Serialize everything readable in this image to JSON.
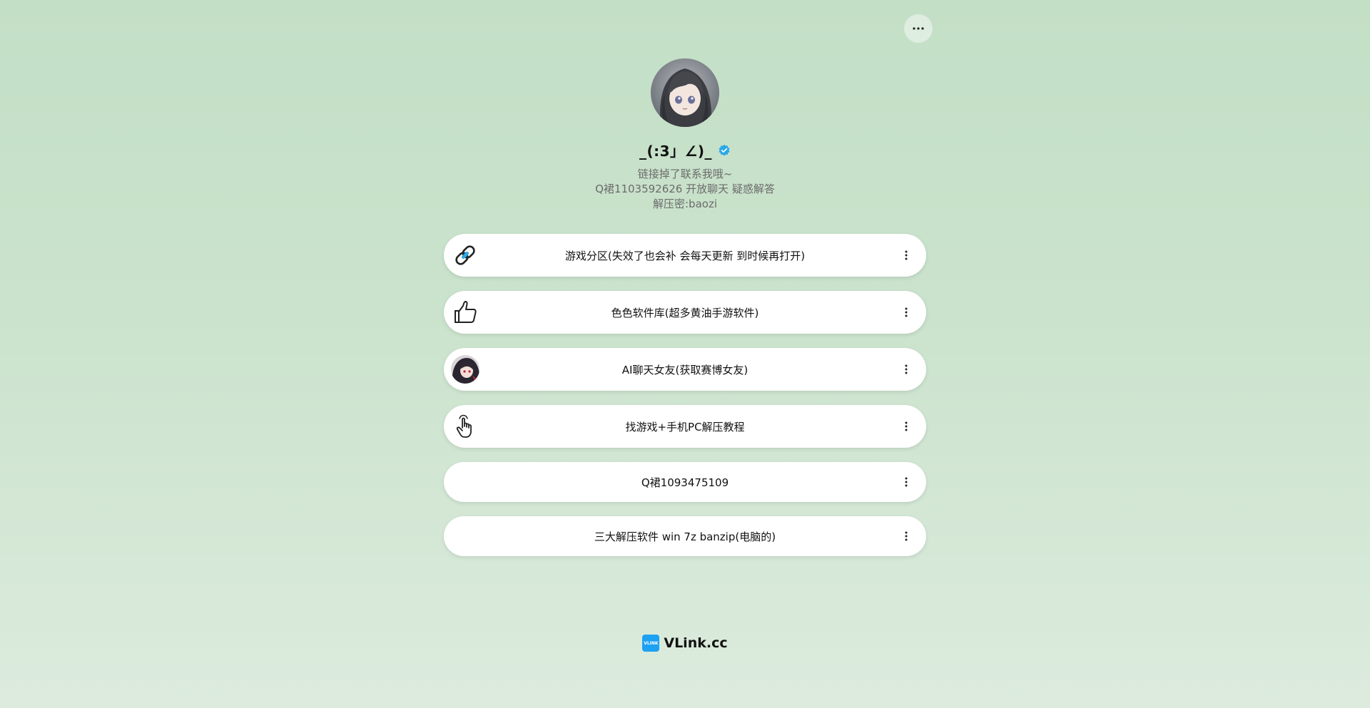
{
  "header": {
    "more_icon": "ellipsis-icon"
  },
  "profile": {
    "avatar_icon": "anime-girl-avatar",
    "name": "_(:3」∠)_",
    "verified_icon": "verified-badge-icon",
    "verified_color": "#2aa8ea",
    "bio_lines": [
      "链接掉了联系我哦~",
      "Q裙1103592626 开放聊天 疑惑解答",
      "解压密:baozi"
    ]
  },
  "links": [
    {
      "label": "游戏分区(失效了也会补 会每天更新 到时候再打开)",
      "icon": "link-chain-icon"
    },
    {
      "label": "色色软件库(超多黄油手游软件)",
      "icon": "thumbs-up-icon"
    },
    {
      "label": "AI聊天女友(获取赛博女友)",
      "icon": "ai-girl-avatar"
    },
    {
      "label": "找游戏+手机PC解压教程",
      "icon": "pointing-hand-icon"
    },
    {
      "label": "Q裙1093475109",
      "icon": ""
    },
    {
      "label": "三大解压软件 win 7z banzip(电脑的)",
      "icon": ""
    }
  ],
  "footer": {
    "logo_text": "VLINK",
    "brand": "VLink.cc",
    "logo_color": "#1da1f2"
  }
}
